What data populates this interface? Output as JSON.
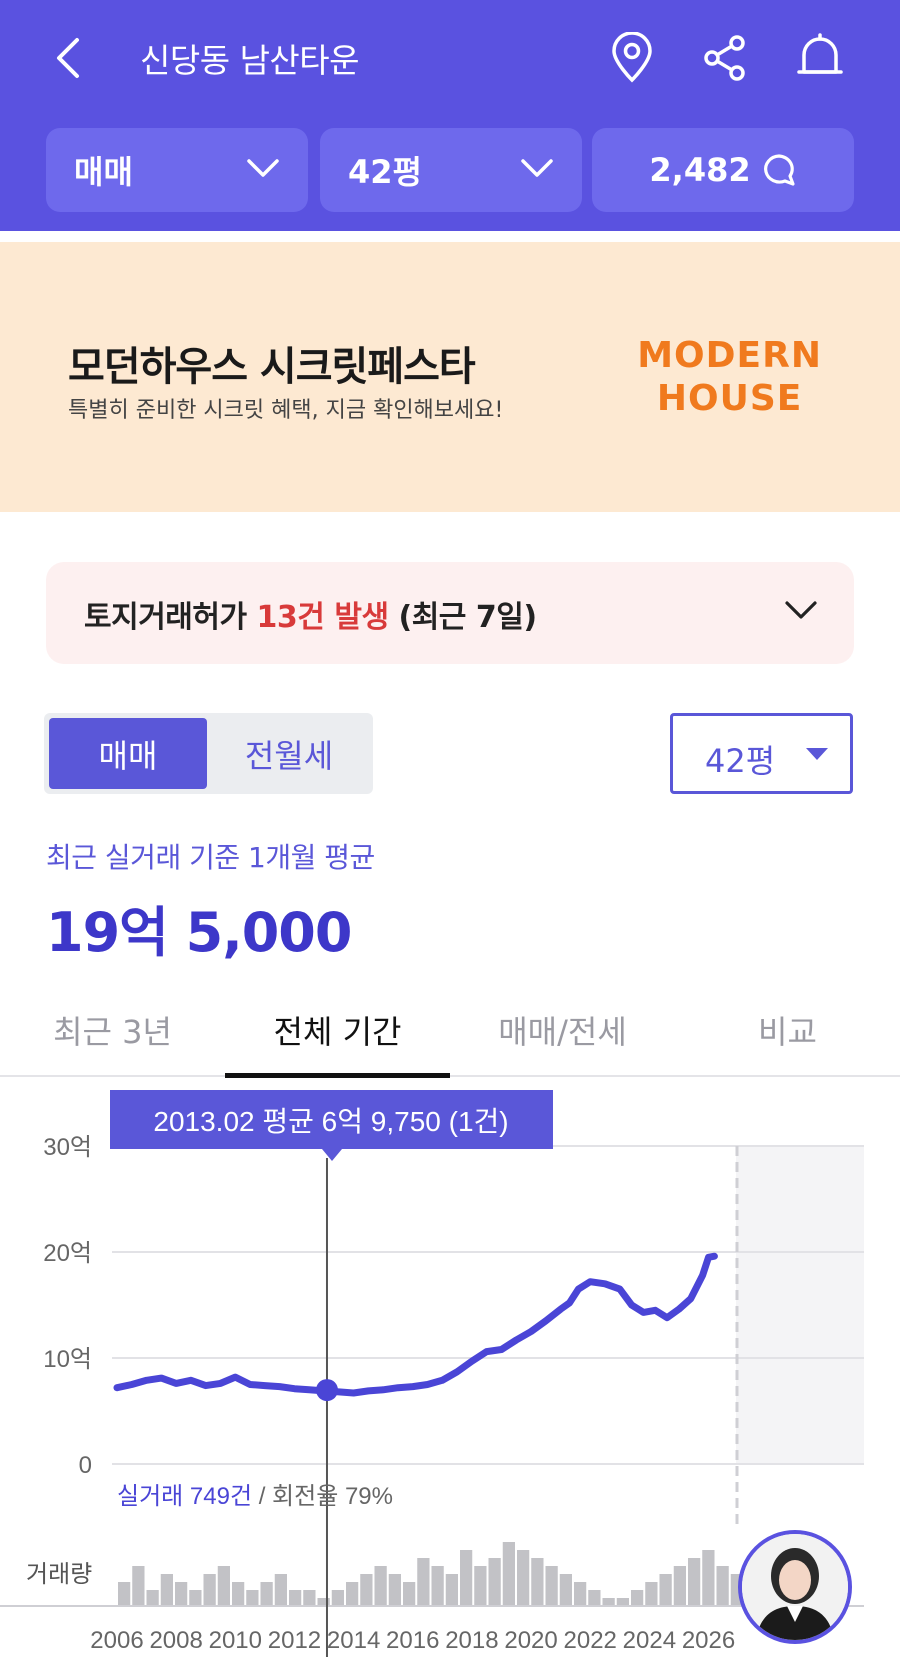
{
  "header": {
    "title": "신당동 남산타운",
    "filters": [
      {
        "label": "매매",
        "dropdown": true
      },
      {
        "label": "42평",
        "dropdown": true
      },
      {
        "label": "2,482",
        "icon": "chat-bubble-icon"
      }
    ]
  },
  "banner": {
    "title": "모던하우스 시크릿페스타",
    "subtitle": "특별히 준비한 시크릿 혜택, 지금 확인해보세요!",
    "brand_line1": "MODERN",
    "brand_line2": "HOUSE"
  },
  "alert": {
    "prefix": "토지거래허가 ",
    "highlight": "13건 발생",
    "suffix": " (최근 7일)"
  },
  "trade_toggle": {
    "active": "매매",
    "inactive": "전월세"
  },
  "size_select": "42평",
  "average": {
    "label": "최근 실거래 기준 1개월 평균",
    "value": "19억 5,000"
  },
  "tabs": [
    "최근 3년",
    "전체 기간",
    "매매/전세",
    "비교"
  ],
  "active_tab": 1,
  "chart": {
    "tooltip": "2013.02 평균 6억 9,750 (1건)",
    "summary": {
      "count": "실거래 749건",
      "sep": " / ",
      "turnover": "회전율 79%"
    },
    "volume_label": "거래량"
  },
  "colors": {
    "primary": "#5a52e0",
    "accent": "#3d37c9",
    "alert": "#d83a3a",
    "brand": "#f07a1e"
  },
  "chart_data": {
    "type": "line",
    "ylabel": "",
    "y_ticks": [
      "30억",
      "20억",
      "10억",
      "0"
    ],
    "ylim": [
      0,
      30
    ],
    "x_ticks": [
      "2006",
      "2008",
      "2010",
      "2012",
      "2014",
      "2016",
      "2018",
      "2020",
      "2022",
      "2024",
      "2026"
    ],
    "xlim": [
      2006,
      2027.2
    ],
    "selected": {
      "x": 2013.1,
      "y": 6.975
    },
    "series": [
      {
        "x": [
          2006.0,
          2006.5,
          2007.0,
          2007.5,
          2008.0,
          2008.5,
          2009.0,
          2009.5,
          2010.0,
          2010.5,
          2011.0,
          2011.5,
          2012.0,
          2012.5,
          2013.0,
          2013.5,
          2014.0,
          2014.5,
          2015.0,
          2015.5,
          2016.0,
          2016.5,
          2017.0,
          2017.5,
          2018.0,
          2018.5,
          2019.0,
          2019.5,
          2020.0,
          2020.5,
          2021.0,
          2021.3,
          2021.6,
          2022.0,
          2022.5,
          2023.0,
          2023.4,
          2023.8,
          2024.2,
          2024.6,
          2025.0,
          2025.4,
          2025.8,
          2026.0,
          2026.2
        ],
        "values": [
          7.2,
          7.5,
          7.9,
          8.1,
          7.6,
          7.9,
          7.4,
          7.6,
          8.2,
          7.5,
          7.4,
          7.3,
          7.1,
          7.0,
          6.9,
          6.8,
          6.7,
          6.9,
          7.0,
          7.2,
          7.3,
          7.5,
          7.9,
          8.7,
          9.7,
          10.6,
          10.8,
          11.7,
          12.5,
          13.5,
          14.6,
          15.2,
          16.5,
          17.2,
          17.0,
          16.5,
          15.0,
          14.3,
          14.5,
          13.8,
          14.6,
          15.6,
          17.8,
          19.5,
          19.6
        ]
      }
    ],
    "volume": [
      3,
      5,
      2,
      4,
      3,
      2,
      4,
      5,
      3,
      2,
      3,
      4,
      2,
      2,
      1,
      2,
      3,
      4,
      5,
      4,
      3,
      6,
      5,
      4,
      7,
      5,
      6,
      8,
      7,
      6,
      5,
      4,
      3,
      2,
      1,
      1,
      2,
      3,
      4,
      5,
      6,
      7,
      5,
      4
    ]
  }
}
